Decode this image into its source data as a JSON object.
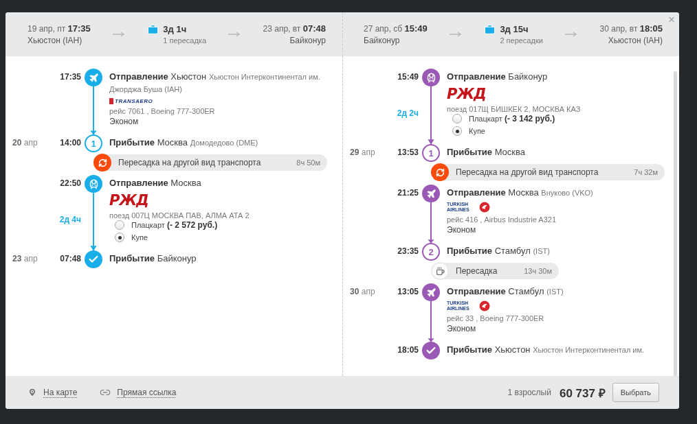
{
  "close": "×",
  "legs": [
    {
      "color": "#19aee9",
      "header": {
        "dep_date": "19 апр, пт",
        "dep_time": "17:35",
        "dep_city": "Хьюстон (IAH)",
        "duration": "3д 1ч",
        "transfers": "1 пересадка",
        "arr_date": "23 апр, вт",
        "arr_time": "07:48",
        "arr_city": "Байконур"
      },
      "events": [
        {
          "kind": "flight",
          "time": "17:35",
          "title": "Отправление",
          "city": "Хьюстон",
          "place": "Хьюстон Интерконтинентал им. Джорджа Буша (IAH)",
          "logo": {
            "kind": "transaero",
            "text": "TRANSAERO"
          },
          "trip": "рейс 7061 , Boeing 777-300ER",
          "cabin": "Эконом"
        },
        {
          "kind": "arrival",
          "day": "20",
          "month": "апр",
          "time": "14:00",
          "number": "1",
          "title": "Прибытие",
          "city": "Москва",
          "place": "Домодедово (DME)"
        },
        {
          "kind": "mode_change",
          "text": "Пересадка на другой вид транспорта",
          "duration": "8ч 50м"
        },
        {
          "kind": "train",
          "time": "22:50",
          "title": "Отправление",
          "city": "Москва",
          "logo": {
            "kind": "rzd",
            "text": "РЖД"
          },
          "trip": "поезд 007Ц МОСКВА ПАВ, АЛМА АТА 2",
          "options": [
            {
              "label": "Плацкарт",
              "price": "(- 2 572 руб.)",
              "selected": false
            },
            {
              "label": "Купе",
              "selected": true
            }
          ],
          "travel": "2д 4ч"
        },
        {
          "kind": "destination",
          "day": "23",
          "month": "апр",
          "time": "07:48",
          "title": "Прибытие",
          "city": "Байконур"
        }
      ]
    },
    {
      "color": "#9b59b6",
      "header": {
        "dep_date": "27 апр, сб",
        "dep_time": "15:49",
        "dep_city": "Байконур",
        "duration": "3д 15ч",
        "transfers": "2 пересадки",
        "arr_date": "30 апр, вт",
        "arr_time": "18:05",
        "arr_city": "Хьюстон (IAH)"
      },
      "events": [
        {
          "kind": "train",
          "time": "15:49",
          "title": "Отправление",
          "city": "Байконур",
          "logo": {
            "kind": "rzd",
            "text": "РЖД"
          },
          "trip": "поезд 017Щ БИШКЕК 2, МОСКВА КАЗ",
          "options": [
            {
              "label": "Плацкарт",
              "price": "(- 3 142 руб.)",
              "selected": false
            },
            {
              "label": "Купе",
              "selected": true
            }
          ],
          "travel": "2д 2ч"
        },
        {
          "kind": "arrival",
          "day": "29",
          "month": "апр",
          "time": "13:53",
          "number": "1",
          "title": "Прибытие",
          "city": "Москва"
        },
        {
          "kind": "mode_change",
          "text": "Пересадка на другой вид транспорта",
          "duration": "7ч 32м"
        },
        {
          "kind": "flight",
          "time": "21:25",
          "title": "Отправление",
          "city": "Москва",
          "place": "Внуково (VKO)",
          "logo": {
            "kind": "turkish",
            "text": "TURKISH AIRLINES"
          },
          "trip": "рейс 416 , Airbus Industrie A321",
          "cabin": "Эконом"
        },
        {
          "kind": "arrival",
          "time": "23:35",
          "number": "2",
          "title": "Прибытие",
          "city": "Стамбул",
          "place": "(IST)"
        },
        {
          "kind": "layover",
          "text": "Пересадка",
          "duration": "13ч 30м"
        },
        {
          "kind": "flight",
          "day": "30",
          "month": "апр",
          "time": "13:05",
          "title": "Отправление",
          "city": "Стамбул",
          "place": "(IST)",
          "logo": {
            "kind": "turkish",
            "text": "TURKISH AIRLINES"
          },
          "trip": "рейс 33 , Boeing 777-300ER",
          "cabin": "Эконом"
        },
        {
          "kind": "destination",
          "time": "18:05",
          "title": "Прибытие",
          "city": "Хьюстон",
          "place": "Хьюстон Интерконтинентал им."
        }
      ]
    }
  ],
  "footer": {
    "links": [
      {
        "label": "На карте"
      },
      {
        "label": "Прямая ссылка"
      }
    ],
    "passengers": "1 взрослый",
    "price": "60 737 ₽",
    "button": "Выбрать"
  }
}
